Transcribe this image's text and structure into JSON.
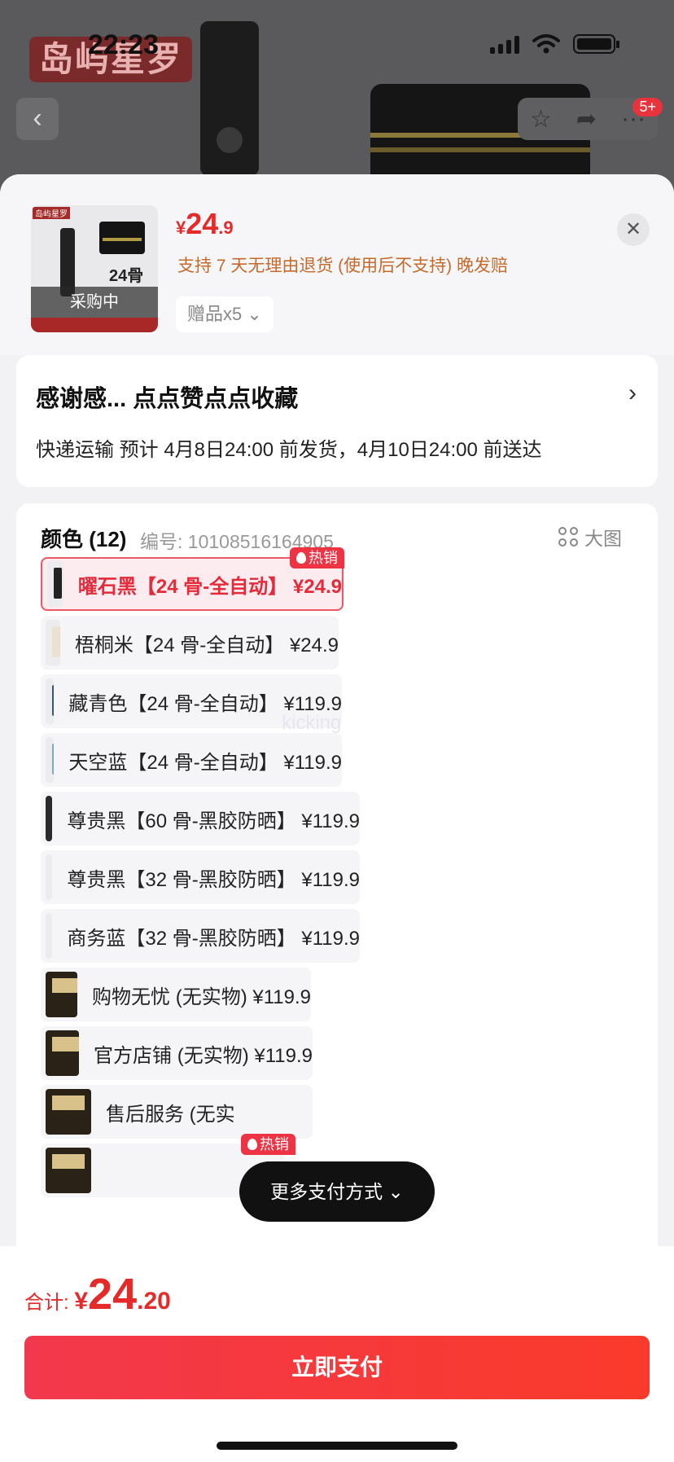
{
  "status_bar": {
    "time": "22:23"
  },
  "background": {
    "logo_text": "岛屿星罗",
    "cart_badge": "5+"
  },
  "product": {
    "price_int": "24",
    "price_dec": ".9",
    "currency": "¥",
    "return_policy": "支持 7 天无理由退货 (使用后不支持)   晚发赔",
    "gift_label": "赠品x5",
    "thumb_status": "采购中",
    "thumb_text": "24骨"
  },
  "shipping": {
    "title": "感谢感...  点点赞点点收藏",
    "detail": "快递运输  预计 4月8日24:00 前发货，4月10日24:00 前送达"
  },
  "color_section": {
    "title": "颜色 (12)",
    "code_label": "编号:  10108516164905",
    "big_pic_label": "大图",
    "hot_label": "热销",
    "options": [
      {
        "label": "曜石黑【24 骨-全自动】 ¥24.9"
      },
      {
        "label": "梧桐米【24 骨-全自动】 ¥24.9"
      },
      {
        "label": "藏青色【24 骨-全自动】 ¥119.9"
      },
      {
        "label": "天空蓝【24 骨-全自动】 ¥119.9"
      },
      {
        "label": "尊贵黑【60 骨-黑胶防晒】 ¥119.9"
      },
      {
        "label": "尊贵黑【32 骨-黑胶防晒】 ¥119.9"
      },
      {
        "label": "商务蓝【32 骨-黑胶防晒】 ¥119.9"
      },
      {
        "label": "购物无忧 (无实物)  ¥119.9"
      },
      {
        "label": "官方店铺 (无实物)  ¥119.9"
      },
      {
        "label": "售后服务 (无实"
      }
    ],
    "watermark": "kicking"
  },
  "more_payment": "更多支付方式 ⌄",
  "footer": {
    "total_label": "合计: ",
    "currency": "¥",
    "total_int": "24",
    "total_dec": ".20",
    "pay_button": "立即支付"
  },
  "colors": {
    "accent": "#e52a2a",
    "selected_bg": "#fdecef",
    "hot_tag": "#ee3344"
  }
}
